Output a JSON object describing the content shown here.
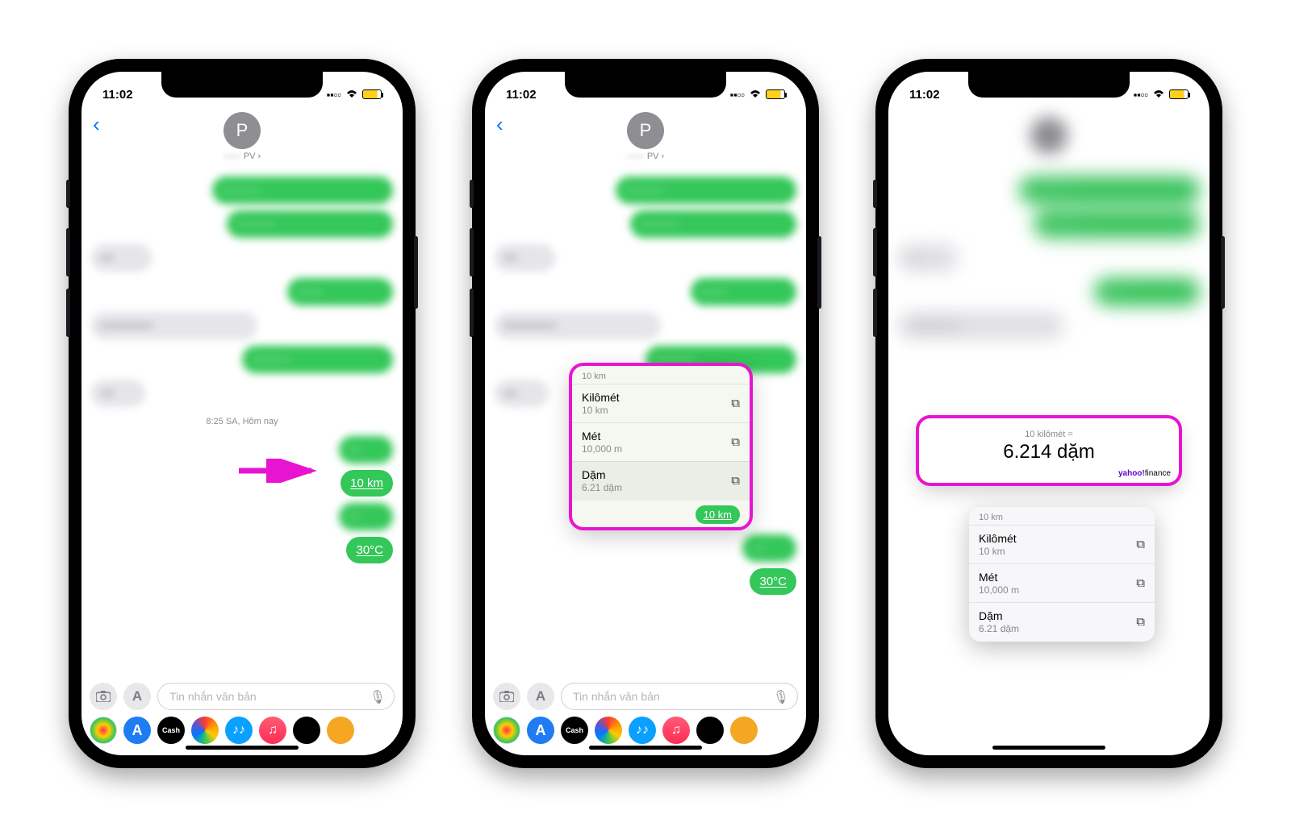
{
  "status": {
    "time": "11:02"
  },
  "header": {
    "avatar_letter": "P",
    "contact_suffix": "PV ›"
  },
  "timestamp": "8:25 SA, Hôm nay",
  "bubbles": {
    "km": "10 km",
    "temp": "30°C"
  },
  "input": {
    "placeholder": "Tin nhắn văn bản"
  },
  "popup": {
    "title": "10 km",
    "items": [
      {
        "name": "Kilômét",
        "value": "10 km"
      },
      {
        "name": "Mét",
        "value": "10,000 m"
      },
      {
        "name": "Dặm",
        "value": "6.21 dặm"
      }
    ],
    "source": "10 km"
  },
  "card": {
    "equation": "10 kilômét =",
    "result": "6.214 dặm",
    "brand_prefix": "yahoo!",
    "brand_suffix": "finance"
  },
  "apps_colors": [
    "#fff",
    "#1f7cf2",
    "#000",
    "#d13a1b",
    "#1aa0ff",
    "#ff2d55",
    "#9b59b6",
    "#f1c40f"
  ]
}
